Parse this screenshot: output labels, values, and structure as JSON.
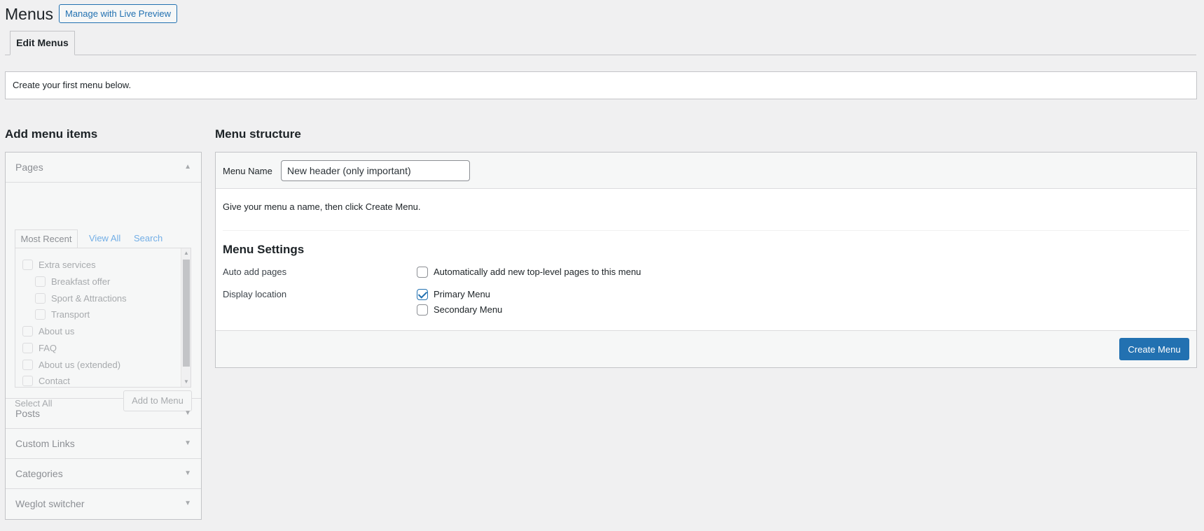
{
  "header": {
    "title": "Menus",
    "live_preview_label": "Manage with Live Preview"
  },
  "tabs": {
    "edit_menus": "Edit Menus"
  },
  "notice": "Create your first menu below.",
  "left": {
    "heading": "Add menu items",
    "pages": {
      "title": "Pages",
      "tabs": [
        "Most Recent",
        "View All",
        "Search"
      ],
      "items": [
        {
          "label": "Extra services",
          "indent": 0
        },
        {
          "label": "Breakfast offer",
          "indent": 1
        },
        {
          "label": "Sport & Attractions",
          "indent": 1
        },
        {
          "label": "Transport",
          "indent": 1
        },
        {
          "label": "About us",
          "indent": 0
        },
        {
          "label": "FAQ",
          "indent": 0
        },
        {
          "label": "About us (extended)",
          "indent": 0
        },
        {
          "label": "Contact",
          "indent": 0
        }
      ],
      "select_all": "Select All",
      "add_to_menu": "Add to Menu"
    },
    "sections": [
      "Posts",
      "Custom Links",
      "Categories",
      "Weglot switcher"
    ]
  },
  "right": {
    "heading": "Menu structure",
    "menu_name_label": "Menu Name",
    "menu_name_value": "New header (only important)",
    "hint": "Give your menu a name, then click Create Menu.",
    "settings_title": "Menu Settings",
    "auto_add_label": "Auto add pages",
    "auto_add_option": "Automatically add new top-level pages to this menu",
    "auto_add_checked": false,
    "display_location_label": "Display location",
    "primary_menu": "Primary Menu",
    "primary_checked": true,
    "secondary_menu": "Secondary Menu",
    "secondary_checked": false,
    "create_button": "Create Menu"
  },
  "colors": {
    "accent": "#2271b1",
    "background": "#f0f0f1"
  }
}
